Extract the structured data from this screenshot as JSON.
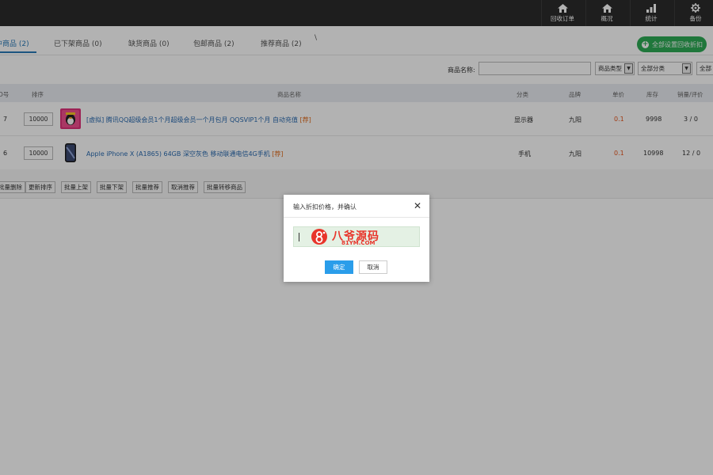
{
  "topnav": {
    "items": [
      {
        "label": "回收订单",
        "icon": "home-icon"
      },
      {
        "label": "概况",
        "icon": "home-icon"
      },
      {
        "label": "统计",
        "icon": "bar-chart-icon"
      },
      {
        "label": "备份",
        "icon": "gear-icon"
      }
    ]
  },
  "tabs": [
    {
      "label": "中商品 (2)",
      "active": true
    },
    {
      "label": "已下架商品 (0)"
    },
    {
      "label": "缺货商品 (0)"
    },
    {
      "label": "包邮商品 (2)"
    },
    {
      "label": "推荐商品 (2)"
    }
  ],
  "tab_extra": "\\",
  "actions": {
    "set_all_discount": "全部设置回收折扣"
  },
  "filters": {
    "name_label": "商品名称:",
    "name_value": "",
    "type_select": "商品类型",
    "category_select": "全部分类",
    "brand_select": "全部"
  },
  "table": {
    "headers": [
      "D号",
      "排序",
      "商品名称",
      "分类",
      "品牌",
      "单价",
      "库存",
      "销量/评价"
    ],
    "rows": [
      {
        "id": "7",
        "sort": "10000",
        "name": "[虚拟] 腾讯QQ超级会员1个月超级会员一个月包月 QQSVIP1个月 自动充值",
        "tag": "[荐]",
        "category": "显示器",
        "brand": "九阳",
        "price": "0.1",
        "stock": "9998",
        "sales": "3 / 0",
        "thumb": "qq-vip-thumbnail"
      },
      {
        "id": "6",
        "sort": "10000",
        "name": "Apple iPhone X (A1865) 64GB 深空灰色 移动联通电信4G手机",
        "tag": "[荐]",
        "category": "手机",
        "brand": "九阳",
        "price": "0.1",
        "stock": "10998",
        "sales": "12 / 0",
        "thumb": "iphone-thumbnail"
      }
    ]
  },
  "batch": [
    "批量删除",
    "更新排序",
    "批量上架",
    "批量下架",
    "批量推荐",
    "取消推荐",
    "批量转移商品"
  ],
  "dialog": {
    "title": "输入折扣价格，并确认",
    "input_watermark_main": "八爷源码",
    "input_watermark_sub": "81YM.COM",
    "ok": "确定",
    "cancel": "取消",
    "close": "✕"
  },
  "colors": {
    "accent": "#2a7ab8",
    "green": "#2dab55",
    "price": "#e5541b",
    "ok_button": "#2a9dea"
  }
}
